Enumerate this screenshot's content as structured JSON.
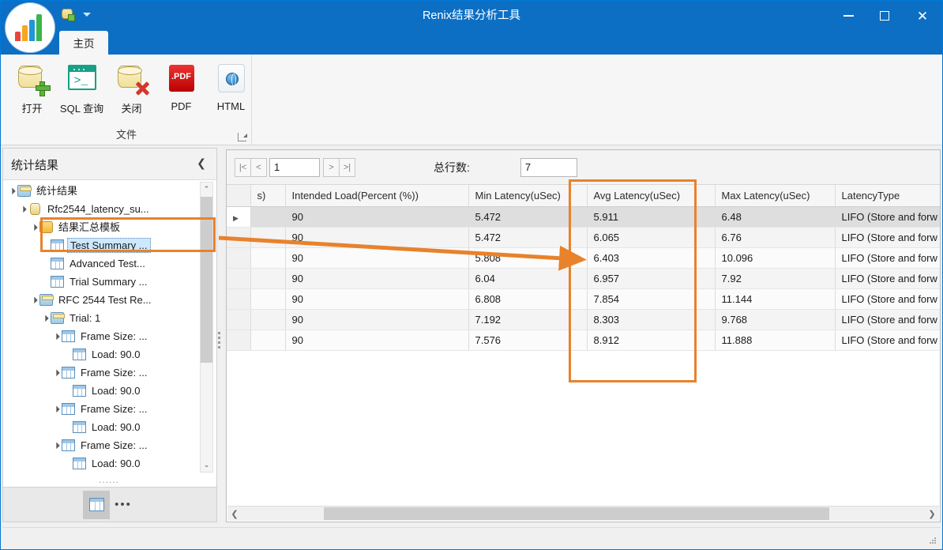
{
  "window": {
    "title": "Renix结果分析工具",
    "controls": {
      "minimize": "–",
      "maximize": "□",
      "close": "✕"
    },
    "accent_color": "#0c6fc4"
  },
  "quick_access": {
    "db_icon": "database-icon",
    "dropdown_icon": "chevron-down-icon"
  },
  "ribbon": {
    "tabs": [
      {
        "label": "主页",
        "active": true
      }
    ],
    "groups": [
      {
        "title": "文件",
        "launcher_icon": "dialog-launcher-icon",
        "items": [
          {
            "label": "打开",
            "icon": "database-add-icon"
          },
          {
            "label": "SQL 查询",
            "icon": "sql-terminal-icon"
          },
          {
            "label": "关闭",
            "icon": "database-close-icon"
          },
          {
            "label": "PDF",
            "icon": "pdf-icon",
            "badge": ".PDF"
          },
          {
            "label": "HTML",
            "icon": "html-globe-icon"
          }
        ]
      }
    ]
  },
  "left_panel": {
    "title": "统计结果",
    "collapse_icon": "chevron-left-icon",
    "tree": [
      {
        "label": "统计结果",
        "indent": 0,
        "icon": "folder-blue-icon",
        "expander": "▲",
        "selected": false
      },
      {
        "label": "Rfc2544_latency_su...",
        "indent": 1,
        "icon": "database-icon",
        "expander": "▲",
        "selected": false
      },
      {
        "label": "结果汇总模板",
        "indent": 2,
        "icon": "folder-yellow-icon",
        "expander": "▲",
        "selected": false
      },
      {
        "label": "Test Summary ...",
        "indent": 3,
        "icon": "grid-icon",
        "expander": "",
        "selected": true
      },
      {
        "label": "Advanced Test...",
        "indent": 3,
        "icon": "grid-icon",
        "expander": "",
        "selected": false
      },
      {
        "label": "Trial Summary ...",
        "indent": 3,
        "icon": "grid-icon",
        "expander": "",
        "selected": false
      },
      {
        "label": "RFC 2544 Test Re...",
        "indent": 2,
        "icon": "folder-blue-icon",
        "expander": "▲",
        "selected": false
      },
      {
        "label": "Trial: 1",
        "indent": 3,
        "icon": "folder-blue-icon",
        "expander": "▲",
        "selected": false
      },
      {
        "label": "Frame Size: ...",
        "indent": 4,
        "icon": "grid-icon",
        "expander": "▲",
        "selected": false
      },
      {
        "label": "Load: 90.0",
        "indent": 5,
        "icon": "grid-icon",
        "expander": "",
        "selected": false
      },
      {
        "label": "Frame Size: ...",
        "indent": 4,
        "icon": "grid-icon",
        "expander": "▲",
        "selected": false
      },
      {
        "label": "Load: 90.0",
        "indent": 5,
        "icon": "grid-icon",
        "expander": "",
        "selected": false
      },
      {
        "label": "Frame Size: ...",
        "indent": 4,
        "icon": "grid-icon",
        "expander": "▲",
        "selected": false
      },
      {
        "label": "Load: 90.0",
        "indent": 5,
        "icon": "grid-icon",
        "expander": "",
        "selected": false
      },
      {
        "label": "Frame Size: ...",
        "indent": 4,
        "icon": "grid-icon",
        "expander": "▲",
        "selected": false
      },
      {
        "label": "Load: 90.0",
        "indent": 5,
        "icon": "grid-icon",
        "expander": "",
        "selected": false
      }
    ],
    "scroll_up_icon": "chevron-up-icon",
    "scroll_down_icon": "chevron-down-icon",
    "overflow_dots": "......",
    "bottom_bar": {
      "grid_view_icon": "grid-view-icon",
      "more_label": "•••"
    }
  },
  "pager": {
    "first_label": "|<",
    "prev_label": "<",
    "page_value": "1",
    "next_label": ">",
    "last_label": ">|",
    "total_rows_label": "总行数:",
    "total_rows_value": "7"
  },
  "grid": {
    "columns": [
      "s)",
      "Intended Load(Percent (%))",
      "Min Latency(uSec)",
      "Avg Latency(uSec)",
      "Max Latency(uSec)",
      "LatencyType"
    ],
    "rows": [
      {
        "marker": "▶",
        "cells": [
          "",
          "90",
          "5.472",
          "5.911",
          "6.48",
          "LIFO (Store and forw"
        ]
      },
      {
        "marker": "",
        "cells": [
          "",
          "90",
          "5.472",
          "6.065",
          "6.76",
          "LIFO (Store and forw"
        ]
      },
      {
        "marker": "",
        "cells": [
          "",
          "90",
          "5.808",
          "6.403",
          "10.096",
          "LIFO (Store and forw"
        ]
      },
      {
        "marker": "",
        "cells": [
          "",
          "90",
          "6.04",
          "6.957",
          "7.92",
          "LIFO (Store and forw"
        ]
      },
      {
        "marker": "",
        "cells": [
          "",
          "90",
          "6.808",
          "7.854",
          "11.144",
          "LIFO (Store and forw"
        ]
      },
      {
        "marker": "",
        "cells": [
          "",
          "90",
          "7.192",
          "8.303",
          "9.768",
          "LIFO (Store and forw"
        ]
      },
      {
        "marker": "",
        "cells": [
          "",
          "90",
          "7.576",
          "8.912",
          "11.888",
          "LIFO (Store and forw"
        ]
      }
    ],
    "hscroll": {
      "left_icon": "chevron-left-icon",
      "right_icon": "chevron-right-icon"
    }
  },
  "annotations": {
    "highlight_color": "#e8822b",
    "boxes": [
      {
        "name": "tree-selection-highlight"
      },
      {
        "name": "avg-latency-column-highlight"
      }
    ],
    "arrow": {
      "name": "pointer-arrow",
      "from": "tree-selection-highlight",
      "to": "avg-latency-column-highlight"
    }
  },
  "statusbar": {
    "resize_grip_icon": "resize-grip-icon"
  }
}
